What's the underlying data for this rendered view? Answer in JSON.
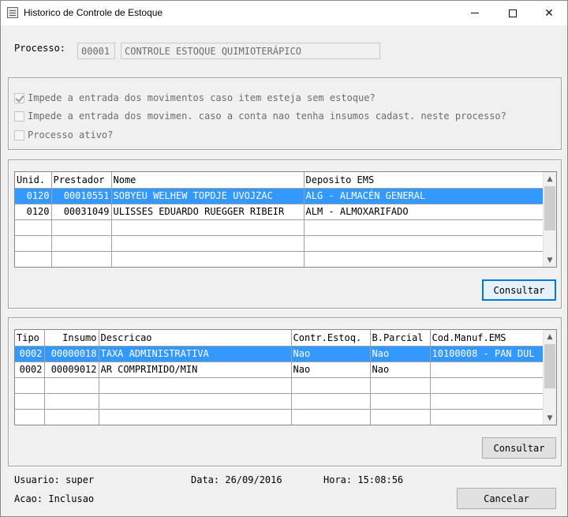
{
  "window": {
    "title": "Historico de Controle de Estoque"
  },
  "titlebar": {
    "minimize": "—",
    "maximize": "☐",
    "close": "✕"
  },
  "processo": {
    "label": "Processo:",
    "code": "00001",
    "description": "CONTROLE ESTOQUE QUIMIOTERÁPICO"
  },
  "options": [
    {
      "label": "Impede a entrada dos movimentos caso item esteja sem estoque?",
      "checked": true
    },
    {
      "label": "Impede a entrada dos movimen. caso a conta nao tenha insumos cadast. neste processo?",
      "checked": false
    },
    {
      "label": "Processo ativo?",
      "checked": false
    }
  ],
  "grid1": {
    "headers": [
      "Unid.",
      "Prestador",
      "Nome",
      "Deposito EMS"
    ],
    "rows": [
      [
        "0120",
        "00010551",
        "SOBYEU WELHEW TOPDJE UVOJZAC",
        "ALG - ALMACÉN GENERAL"
      ],
      [
        "0120",
        "00031049",
        "ULISSES EDUARDO RUEGGER RIBEIR",
        "ALM - ALMOXARIFADO"
      ]
    ],
    "selected_row": 0,
    "button": "Consultar"
  },
  "grid2": {
    "headers": [
      "Tipo",
      "Insumo",
      "Descricao",
      "Contr.Estoq.",
      "B.Parcial",
      "Cod.Manuf.EMS"
    ],
    "rows": [
      [
        "0002",
        "00000018",
        "TAXA ADMINISTRATIVA",
        "Nao",
        "Nao",
        "10100008 - PAN DUL"
      ],
      [
        "0002",
        "00009012",
        "AR COMPRIMIDO/MIN",
        "Nao",
        "Nao",
        ""
      ]
    ],
    "selected_row": 0,
    "button": "Consultar"
  },
  "status": {
    "usuario": "Usuario: super",
    "data": "Data: 26/09/2016",
    "hora": "Hora: 15:08:56",
    "acao": "Acao: Inclusao"
  },
  "cancel_button": "Cancelar"
}
